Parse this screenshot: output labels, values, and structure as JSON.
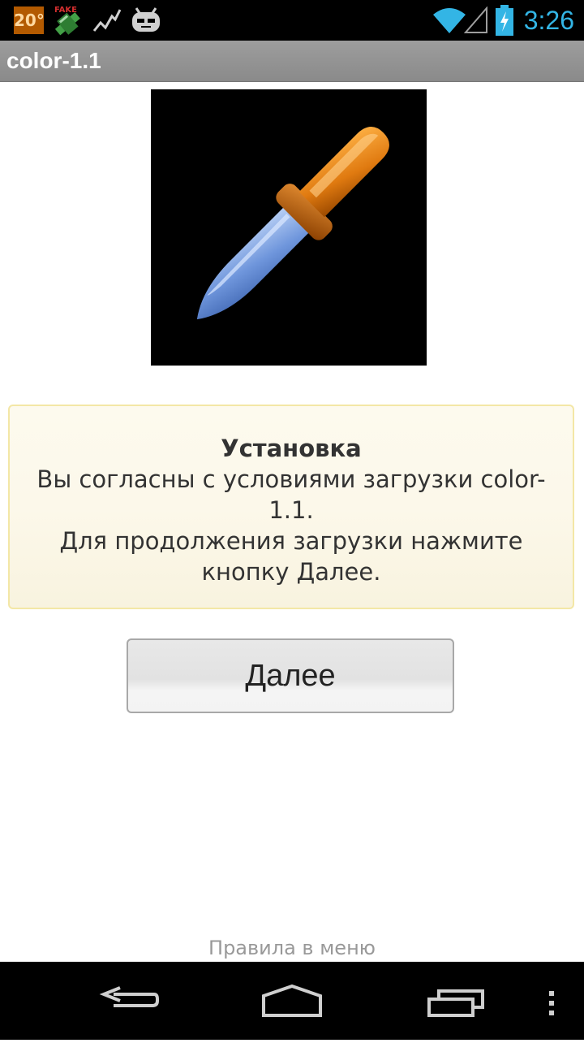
{
  "status_bar": {
    "temperature": "20°",
    "time": "3:26",
    "fake_label": "FAKE",
    "icons": [
      "temperature-icon",
      "fake-gps-icon",
      "activity-chart-icon",
      "android-bot-icon",
      "wifi-icon",
      "signal-icon",
      "battery-charging-icon"
    ]
  },
  "app": {
    "title": "color-1.1"
  },
  "image": {
    "icon": "eyedropper-icon"
  },
  "notice": {
    "heading": "Установка",
    "line1": "Вы согласны с условиями загрузки color-1.1.",
    "line2": "Для продолжения загрузки нажмите кнопку Далее."
  },
  "buttons": {
    "next_label": "Далее"
  },
  "footer": {
    "rules_link": "Правила в меню"
  },
  "navigation": {
    "icons": [
      "back-icon",
      "home-icon",
      "recent-apps-icon",
      "overflow-menu-icon"
    ]
  },
  "colors": {
    "accent": "#33b5e5",
    "notice_bg": "#fcf8ea",
    "notice_border": "#f3e7a6"
  }
}
